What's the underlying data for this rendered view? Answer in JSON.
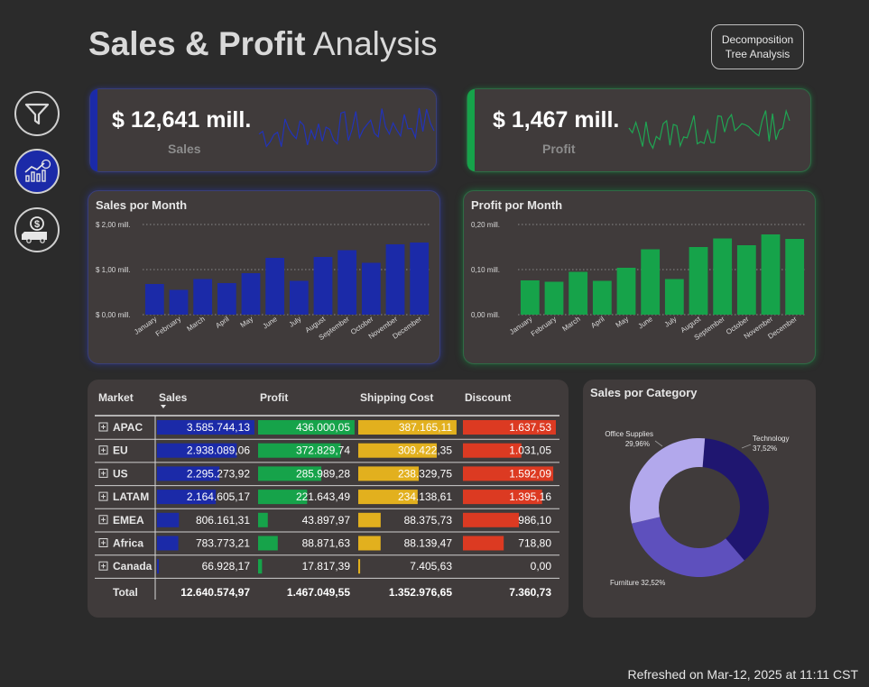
{
  "header": {
    "title_bold": "Sales & Profit",
    "title_light": " Analysis",
    "decomposition_button": "Decomposition\nTree Analysis"
  },
  "nav": [
    {
      "icon": "filter-icon"
    },
    {
      "icon": "sales-chart-icon",
      "active": true
    },
    {
      "icon": "delivery-truck-icon"
    }
  ],
  "kpis": {
    "sales": {
      "value": "$ 12,641 mill.",
      "label": "Sales",
      "color": "#1b2aa8"
    },
    "profit": {
      "value": "$ 1,467 mill.",
      "label": "Profit",
      "color": "#16a34a"
    }
  },
  "colors": {
    "sales": "#1b2aa8",
    "profit": "#16a34a",
    "shipping": "#e2b01e",
    "discount": "#dc3a22",
    "office": "#b2a8ec",
    "furniture": "#5e50bd",
    "technology": "#1f1670"
  },
  "chart_data": [
    {
      "type": "bar",
      "title": "Sales por Month",
      "categories": [
        "January",
        "February",
        "March",
        "April",
        "May",
        "June",
        "July",
        "August",
        "September",
        "October",
        "November",
        "December"
      ],
      "values": [
        0.68,
        0.55,
        0.79,
        0.7,
        0.92,
        1.26,
        0.75,
        1.28,
        1.43,
        1.15,
        1.56,
        1.6
      ],
      "ylim": [
        0,
        2
      ],
      "yticks": [
        "$ 0,00 mill.",
        "$ 1,00 mill.",
        "$ 2,00 mill."
      ],
      "ytick_values": [
        0,
        1,
        2
      ],
      "grid": true
    },
    {
      "type": "bar",
      "title": "Profit por Month",
      "categories": [
        "January",
        "February",
        "March",
        "April",
        "May",
        "June",
        "July",
        "August",
        "September",
        "October",
        "November",
        "December"
      ],
      "values": [
        0.076,
        0.073,
        0.095,
        0.075,
        0.104,
        0.145,
        0.079,
        0.15,
        0.169,
        0.154,
        0.178,
        0.168
      ],
      "ylim": [
        0,
        0.2
      ],
      "yticks": [
        "0,00 mill.",
        "0,10 mill.",
        "0,20 mill."
      ],
      "ytick_values": [
        0,
        0.1,
        0.2
      ],
      "grid": true
    },
    {
      "type": "pie",
      "title": "Sales por Category",
      "labels": [
        "Technology 37,52%",
        "Furniture 32,52%",
        "Office Supplies 29,96%"
      ],
      "values": [
        37.52,
        32.52,
        29.96
      ]
    }
  ],
  "table": {
    "columns": [
      "Market",
      "Sales",
      "Profit",
      "Shipping Cost",
      "Discount"
    ],
    "rows": [
      {
        "market": "APAC",
        "sales": "3.585.744,13",
        "profit": "436.000,05",
        "shipping": "387.165,11",
        "discount": "1.637,53",
        "v": [
          3585744.13,
          436000.05,
          387165.11,
          1637.53
        ]
      },
      {
        "market": "EU",
        "sales": "2.938.089,06",
        "profit": "372.829,74",
        "shipping": "309.422,35",
        "discount": "1.031,05",
        "v": [
          2938089.06,
          372829.74,
          309422.35,
          1031.05
        ]
      },
      {
        "market": "US",
        "sales": "2.295.273,92",
        "profit": "285.989,28",
        "shipping": "238.329,75",
        "discount": "1.592,09",
        "v": [
          2295273.92,
          285989.28,
          238329.75,
          1592.09
        ]
      },
      {
        "market": "LATAM",
        "sales": "2.164.605,17",
        "profit": "221.643,49",
        "shipping": "234.138,61",
        "discount": "1.395,16",
        "v": [
          2164605.17,
          221643.49,
          234138.61,
          1395.16
        ]
      },
      {
        "market": "EMEA",
        "sales": "806.161,31",
        "profit": "43.897,97",
        "shipping": "88.375,73",
        "discount": "986,10",
        "v": [
          806161.31,
          43897.97,
          88375.73,
          986.1
        ]
      },
      {
        "market": "Africa",
        "sales": "783.773,21",
        "profit": "88.871,63",
        "shipping": "88.139,47",
        "discount": "718,80",
        "v": [
          783773.21,
          88871.63,
          88139.47,
          718.8
        ]
      },
      {
        "market": "Canada",
        "sales": "66.928,17",
        "profit": "17.817,39",
        "shipping": "7.405,63",
        "discount": "0,00",
        "v": [
          66928.17,
          17817.39,
          7405.63,
          0
        ]
      }
    ],
    "total": {
      "label": "Total",
      "sales": "12.640.574,97",
      "profit": "1.467.049,55",
      "shipping": "1.352.976,65",
      "discount": "7.360,73"
    }
  },
  "footer": {
    "refreshed": "Refreshed on Mar-12, 2025 at 11:11 CST"
  }
}
